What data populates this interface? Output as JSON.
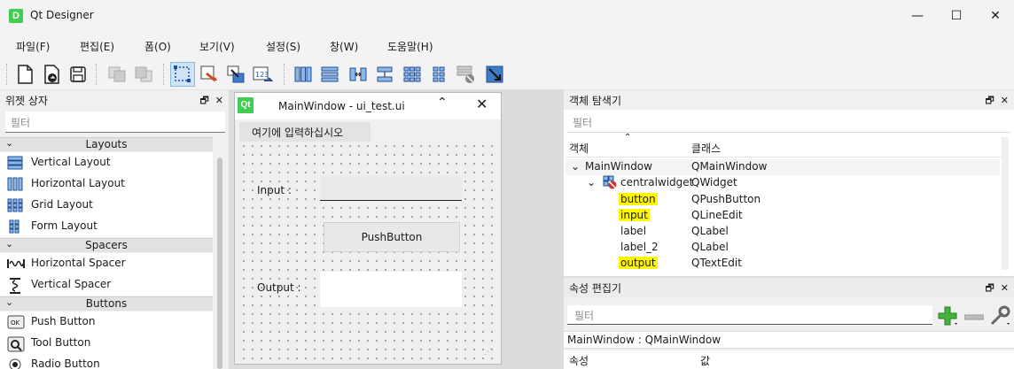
{
  "app": {
    "title": "Qt Designer",
    "icon_letter": "D"
  },
  "window_controls": {
    "minimize": "—",
    "maximize": "☐",
    "close": "✕"
  },
  "menu": [
    "파일(F)",
    "편집(E)",
    "폼(O)",
    "보기(V)",
    "설정(S)",
    "창(W)",
    "도움말(H)"
  ],
  "widget_box": {
    "title": "위젯 상자",
    "filter_placeholder": "필터",
    "categories": [
      {
        "name": "Layouts",
        "items": [
          "Vertical Layout",
          "Horizontal Layout",
          "Grid Layout",
          "Form Layout"
        ]
      },
      {
        "name": "Spacers",
        "items": [
          "Horizontal Spacer",
          "Vertical Spacer"
        ]
      },
      {
        "name": "Buttons",
        "items": [
          "Push Button",
          "Tool Button",
          "Radio Button"
        ]
      }
    ]
  },
  "form": {
    "title": "MainWindow - ui_test.ui",
    "menu_placeholder": "여기에 입력하십시오",
    "input_label": "Input :",
    "button_label": "PushButton",
    "output_label": "Output :"
  },
  "object_inspector": {
    "title": "객체 탐색기",
    "filter_placeholder": "필터",
    "col_object": "객체",
    "col_class": "클래스",
    "rows": [
      {
        "name": "MainWindow",
        "cls": "QMainWindow",
        "level": 0,
        "highlight": false
      },
      {
        "name": "centralwidget",
        "cls": "QWidget",
        "level": 1,
        "highlight": false
      },
      {
        "name": "button",
        "cls": "QPushButton",
        "level": 2,
        "highlight": true
      },
      {
        "name": "input",
        "cls": "QLineEdit",
        "level": 2,
        "highlight": true
      },
      {
        "name": "label",
        "cls": "QLabel",
        "level": 2,
        "highlight": false
      },
      {
        "name": "label_2",
        "cls": "QLabel",
        "level": 2,
        "highlight": false
      },
      {
        "name": "output",
        "cls": "QTextEdit",
        "level": 2,
        "highlight": true
      }
    ]
  },
  "property_editor": {
    "title": "속성 편집기",
    "filter_placeholder": "필터",
    "object_line": "MainWindow : QMainWindow",
    "col_property": "속성",
    "col_value": "값"
  },
  "colors": {
    "highlight": "#fff700",
    "qt_green": "#41cd52",
    "selected_tool": "#cfe3f7"
  }
}
